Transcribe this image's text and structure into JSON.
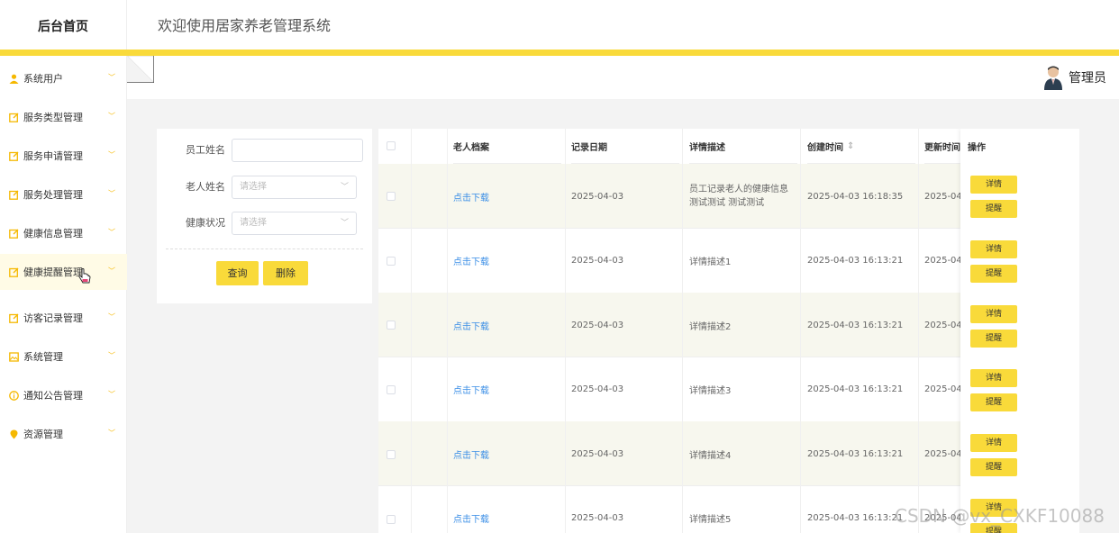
{
  "header": {
    "logo": "后台首页",
    "welcome": "欢迎使用居家养老管理系统"
  },
  "sidebar": {
    "items": [
      {
        "label": "系统用户",
        "icon": "user-icon"
      },
      {
        "label": "服务类型管理",
        "icon": "edit-icon"
      },
      {
        "label": "服务申请管理",
        "icon": "edit-icon"
      },
      {
        "label": "服务处理管理",
        "icon": "edit-icon"
      },
      {
        "label": "健康信息管理",
        "icon": "edit-icon"
      },
      {
        "label": "健康提醒管理",
        "icon": "edit-icon"
      },
      {
        "label": "访客记录管理",
        "icon": "edit-icon"
      },
      {
        "label": "系统管理",
        "icon": "image-icon"
      },
      {
        "label": "通知公告管理",
        "icon": "info-icon"
      },
      {
        "label": "资源管理",
        "icon": "location-icon"
      }
    ]
  },
  "topbar": {
    "admin_name": "管理员"
  },
  "search": {
    "employee_label": "员工姓名",
    "employee_value": "",
    "elder_label": "老人姓名",
    "elder_placeholder": "请选择",
    "health_label": "健康状况",
    "health_placeholder": "请选择",
    "query_button": "查询",
    "delete_button": "删除"
  },
  "table": {
    "headers": {
      "archive": "老人档案",
      "date": "记录日期",
      "desc": "详情描述",
      "created": "创建时间",
      "updated": "更新时间",
      "ops": "操作"
    },
    "sort_icon": "⇕",
    "detail_button": "详情",
    "remind_button": "提醒",
    "rows": [
      {
        "archive": "点击下载",
        "date": "2025-04-03",
        "desc": "员工记录老人的健康信息 测试测试 测试测试",
        "created": "2025-04-03 16:18:35",
        "updated": "2025-04-0"
      },
      {
        "archive": "点击下载",
        "date": "2025-04-03",
        "desc": "详情描述1",
        "created": "2025-04-03 16:13:21",
        "updated": "2025-04-0"
      },
      {
        "archive": "点击下载",
        "date": "2025-04-03",
        "desc": "详情描述2",
        "created": "2025-04-03 16:13:21",
        "updated": "2025-04-0"
      },
      {
        "archive": "点击下载",
        "date": "2025-04-03",
        "desc": "详情描述3",
        "created": "2025-04-03 16:13:21",
        "updated": "2025-04-0"
      },
      {
        "archive": "点击下载",
        "date": "2025-04-03",
        "desc": "详情描述4",
        "created": "2025-04-03 16:13:21",
        "updated": "2025-04-0"
      },
      {
        "archive": "点击下载",
        "date": "2025-04-03",
        "desc": "详情描述5",
        "created": "2025-04-03 16:13:21",
        "updated": "2025-04-0"
      }
    ]
  },
  "watermark": "CSDN @vx_CXKF10088",
  "colors": {
    "accent": "#f9da3a",
    "link": "#3a8ee6",
    "stripe": "#f7f7ee"
  }
}
